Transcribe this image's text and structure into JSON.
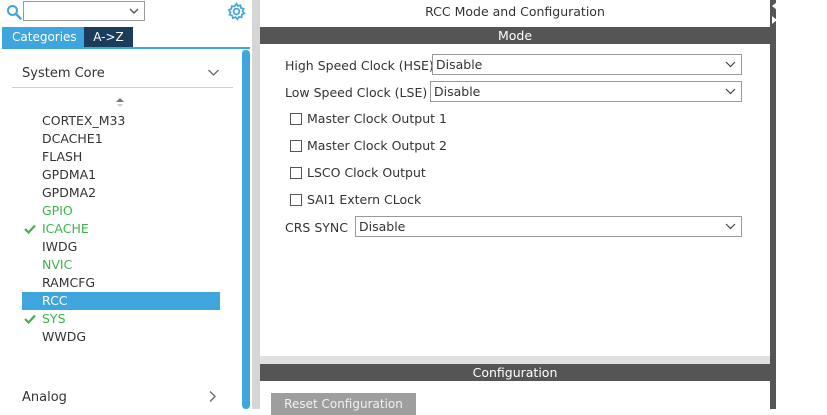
{
  "left_panel": {
    "search": {
      "value": ""
    },
    "tabs": {
      "categories": "Categories",
      "atoz": "A->Z"
    },
    "category": {
      "label": "System Core"
    },
    "peripherals": [
      {
        "label": "CORTEX_M33",
        "state": "normal",
        "checked": false
      },
      {
        "label": "DCACHE1",
        "state": "normal",
        "checked": false
      },
      {
        "label": "FLASH",
        "state": "normal",
        "checked": false
      },
      {
        "label": "GPDMA1",
        "state": "normal",
        "checked": false
      },
      {
        "label": "GPDMA2",
        "state": "normal",
        "checked": false
      },
      {
        "label": "GPIO",
        "state": "green",
        "checked": false
      },
      {
        "label": "ICACHE",
        "state": "green",
        "checked": true
      },
      {
        "label": "IWDG",
        "state": "normal",
        "checked": false
      },
      {
        "label": "NVIC",
        "state": "green",
        "checked": false
      },
      {
        "label": "RAMCFG",
        "state": "normal",
        "checked": false
      },
      {
        "label": "RCC",
        "state": "selected",
        "checked": false
      },
      {
        "label": "SYS",
        "state": "green",
        "checked": true
      },
      {
        "label": "WWDG",
        "state": "normal",
        "checked": false
      }
    ],
    "next_category": {
      "label": "Analog"
    }
  },
  "right_panel": {
    "title": "RCC Mode and Configuration",
    "mode_header": "Mode",
    "hse": {
      "label": "High Speed Clock (HSE)",
      "value": "Disable"
    },
    "lse": {
      "label": "Low Speed Clock (LSE)",
      "value": "Disable"
    },
    "checkboxes": [
      {
        "label": "Master Clock Output 1",
        "checked": false
      },
      {
        "label": "Master Clock Output 2",
        "checked": false
      },
      {
        "label": "LSCO Clock Output",
        "checked": false
      },
      {
        "label": "SAI1 Extern CLock",
        "checked": false
      }
    ],
    "crs_sync": {
      "label": "CRS SYNC",
      "value": "Disable"
    },
    "config_header": "Configuration",
    "reset_button": "Reset Configuration"
  },
  "colors": {
    "accent": "#3ea6dd",
    "tab_dark": "#1b3d5c",
    "active_green": "#3cb44b",
    "section_bar": "#555555"
  },
  "icons": {
    "search": "search-icon",
    "settings": "gear-icon",
    "dropdown": "chevron-down-icon",
    "expand": "chevron-right-icon",
    "sort": "sort-up-icon",
    "check": "checkmark-icon"
  }
}
